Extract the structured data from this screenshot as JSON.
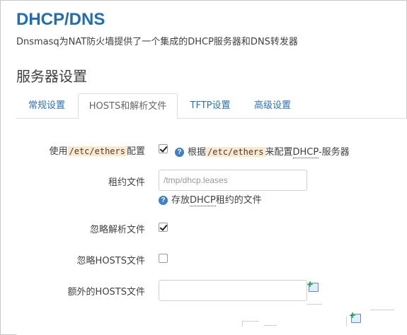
{
  "header": {
    "title": "DHCP/DNS",
    "description": "Dnsmasq为NAT防火墙提供了一个集成的DHCP服务器和DNS转发器"
  },
  "section": {
    "title": "服务器设置"
  },
  "tabs": [
    {
      "label": "常规设置",
      "active": false
    },
    {
      "label": "HOSTS和解析文件",
      "active": true
    },
    {
      "label": "TFTP设置",
      "active": false
    },
    {
      "label": "高级设置",
      "active": false
    }
  ],
  "fields": {
    "use_ethers": {
      "label_pre": "使用",
      "label_code": "/etc/ethers",
      "label_post": "配置",
      "checked": true,
      "help_pre": "根据",
      "help_code": "/etc/ethers",
      "help_mid": "来配置",
      "help_abbr": "DHCP",
      "help_post": "-服务器"
    },
    "leasefile": {
      "label": "租约文件",
      "placeholder": "/tmp/dhcp.leases",
      "value": "",
      "help_pre": "存放",
      "help_abbr": "DHCP",
      "help_post": "租约的文件"
    },
    "ignore_resolv": {
      "label": "忽略解析文件",
      "checked": true
    },
    "ignore_hosts": {
      "label": "忽略HOSTS文件",
      "checked": false
    },
    "extra_hosts": {
      "label": "额外的HOSTS文件",
      "value": ""
    }
  },
  "icons": {
    "help": "help-icon",
    "add": "add-icon",
    "accent": "#1f6db5"
  }
}
